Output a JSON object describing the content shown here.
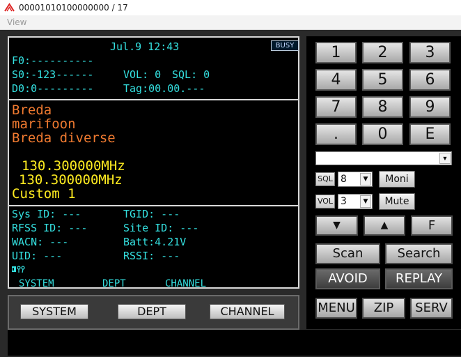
{
  "window": {
    "title": "00001010100000000 / 17",
    "icon": "app-logo-icon"
  },
  "menu": {
    "view": "View"
  },
  "lcd": {
    "datetime": "Jul.9 12:43",
    "busy": "BUSY",
    "f0": "F0:----------",
    "s0": "S0:-123------",
    "vol": "VOL: 0",
    "sql": "SQL: 0",
    "d0": "D0:0---------",
    "tag": "Tag:00.00.---",
    "line1": "Breda",
    "line2": "marifoon",
    "line3": "Breda diverse",
    "freq1": "130.300000MHz",
    "freq2": "130.300000MHz",
    "custom": "Custom 1",
    "sys_id": "Sys ID: ---",
    "tgid": "TGID: ---",
    "rfss_id": "RFSS ID: ---",
    "site_id": "Site ID: ---",
    "wacn": "WACN: ---",
    "batt": "Batt:4.21V",
    "uid": "UID: ---",
    "rssi": "RSSI: ---",
    "soft1": "SYSTEM",
    "soft2": "DEPT",
    "soft3": "CHANNEL"
  },
  "lower_buttons": {
    "system": "SYSTEM",
    "dept": "DEPT",
    "channel": "CHANNEL"
  },
  "keypad": {
    "keys": [
      "1",
      "2",
      "3",
      "4",
      "5",
      "6",
      "7",
      "8",
      "9",
      ".",
      "0",
      "E"
    ],
    "dropdown_value": "",
    "sql_label": "SQL",
    "sql_value": "8",
    "vol_label": "VOL",
    "vol_value": "3",
    "moni": "Moni",
    "mute": "Mute",
    "f": "F",
    "scan": "Scan",
    "search": "Search",
    "avoid": "AVOID",
    "replay": "REPLAY",
    "menu": "MENU",
    "zip": "ZIP",
    "serv": "SERV"
  }
}
